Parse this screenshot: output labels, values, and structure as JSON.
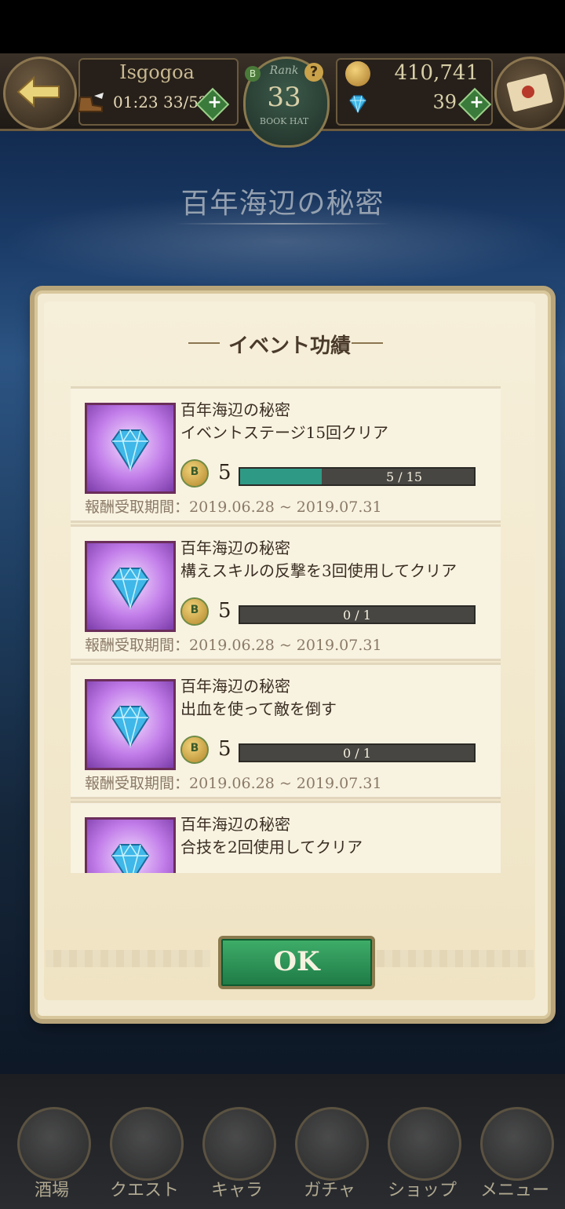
{
  "header": {
    "player_name": "Isgogoa",
    "stamina_timer": "01:23",
    "stamina": "33/52",
    "rank_label": "Rank",
    "rank": "33",
    "rank_sub": "BOOK HAT",
    "b_label": "B",
    "info_label": "?",
    "gold": "410,741",
    "gems": "39",
    "plus_label": "+"
  },
  "event_title": "百年海辺の秘密",
  "dialog": {
    "title": "イベント功績",
    "ok_label": "OK",
    "items": [
      {
        "title": "百年海辺の秘密",
        "desc": "イベントステージ15回クリア",
        "reward": "5",
        "progress": "5 / 15",
        "progress_fraction": 0.333,
        "period": "報酬受取期間：2019.06.28 ~ 2019.07.31"
      },
      {
        "title": "百年海辺の秘密",
        "desc": "構えスキルの反撃を3回使用してクリア",
        "reward": "5",
        "progress": "0 / 1",
        "progress_fraction": 0,
        "period": "報酬受取期間：2019.06.28 ~ 2019.07.31"
      },
      {
        "title": "百年海辺の秘密",
        "desc": "出血を使って敵を倒す",
        "reward": "5",
        "progress": "0 / 1",
        "progress_fraction": 0,
        "period": "報酬受取期間：2019.06.28 ~ 2019.07.31"
      },
      {
        "title": "百年海辺の秘密",
        "desc": "合技を2回使用してクリア"
      }
    ]
  },
  "bottom_nav": [
    "酒場",
    "クエスト",
    "キャラ",
    "ガチャ",
    "ショップ",
    "メニュー"
  ],
  "colors": {
    "accent": "#2e9a86",
    "ok_button": "#2f9458",
    "parchment": "#f3ebd3"
  }
}
